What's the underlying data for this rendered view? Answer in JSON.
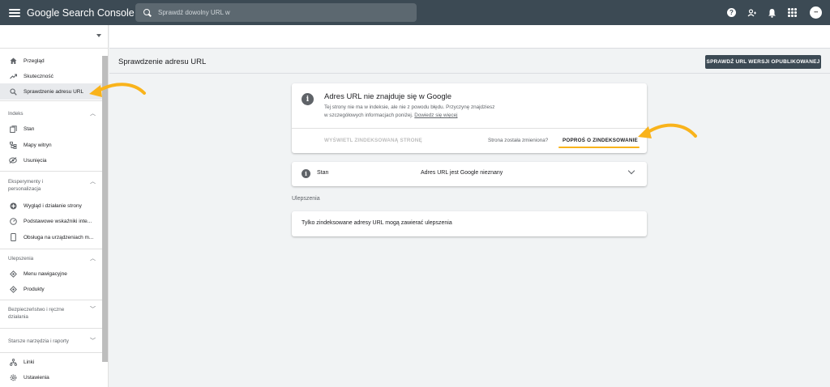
{
  "app": {
    "title": "Google Search Console"
  },
  "search": {
    "placeholder": "Sprawdź dowolny URL w"
  },
  "topbar_icons": [
    "help-icon",
    "account-icon",
    "bell-icon",
    "apps-grid-icon",
    "avatar"
  ],
  "accent_color": "#f9b31b",
  "sidebar": {
    "nav_top": [
      {
        "label": "Przegląd",
        "icon": "home-icon"
      },
      {
        "label": "Skuteczność",
        "icon": "trending-up-icon"
      },
      {
        "label": "Sprawdzenie adresu URL",
        "icon": "search-icon",
        "active": true
      }
    ],
    "sections": [
      {
        "title": "Indeks",
        "items": [
          "Stan",
          "Mapy witryn",
          "Usunięcia"
        ]
      },
      {
        "title": "Eksperymenty i personalizacja",
        "items": [
          "Wygląd i działanie strony",
          "Podstawowe wskaźniki inte...",
          "Obsługa na urządzeniach m..."
        ]
      },
      {
        "title": "Ulepszenia",
        "items": [
          "Menu nawigacyjne",
          "Produkty"
        ]
      },
      {
        "title": "Bezpieczeństwo i ręczne działania",
        "items": []
      },
      {
        "title": "Starsze narzędzia i raporty",
        "items": []
      }
    ],
    "nav_bottom": [
      {
        "label": "Linki",
        "icon": "links-icon"
      },
      {
        "label": "Ustawienia",
        "icon": "settings-icon"
      }
    ]
  },
  "page": {
    "title": "Sprawdzenie adresu URL",
    "inspect_live_button": "SPRAWDŹ URL WERSJI OPUBLIKOWANEJ"
  },
  "status_card": {
    "title": "Adres URL nie znajduje się w Google",
    "desc_line1": "Tej strony nie ma w indeksie, ale nie z powodu błędu. Przyczynę znajdziesz",
    "desc_line2": "w szczegółowych informacjach poniżej.",
    "learn_more": "Dowiedz się więcej",
    "view_indexed": "WYŚWIETL ZINDEKSOWANĄ STRONĘ",
    "changed_question": "Strona została zmieniona?",
    "request_indexing": "POPROŚ O ZINDEKSOWANIE"
  },
  "state_card": {
    "label": "Stan",
    "value": "Adres URL jest Google nieznany"
  },
  "enhancements": {
    "label": "Ulepszenia",
    "text": "Tylko zindeksowane adresy URL mogą zawierać ulepszenia"
  }
}
